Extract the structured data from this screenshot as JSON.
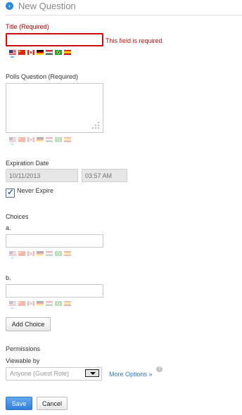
{
  "header": {
    "title": "New Question",
    "back_icon": "back-arrow-icon"
  },
  "title_field": {
    "label": "Title (Required)",
    "value": "",
    "error": "This field is required."
  },
  "languages": [
    "us",
    "cn",
    "ca",
    "de",
    "hu",
    "br",
    "es"
  ],
  "question_field": {
    "label": "Polls Question (Required)",
    "value": ""
  },
  "expiration": {
    "label": "Expiration Date",
    "date": "10/11/2013",
    "time": "03:57 AM",
    "never_expire_label": "Never Expire",
    "never_expire_checked": true
  },
  "choices": {
    "label": "Choices",
    "items": [
      {
        "letter": "a.",
        "value": ""
      },
      {
        "letter": "b.",
        "value": ""
      }
    ],
    "add_label": "Add Choice"
  },
  "permissions": {
    "label": "Permissions",
    "viewable_label": "Viewable by",
    "viewable_value": "Anyone (Guest Role)",
    "more_options": "More Options »"
  },
  "actions": {
    "save_label": "Save",
    "cancel_label": "Cancel"
  },
  "colors": {
    "accent": "#2e7fdb",
    "error": "#c81010",
    "link": "#2a7ad0"
  }
}
